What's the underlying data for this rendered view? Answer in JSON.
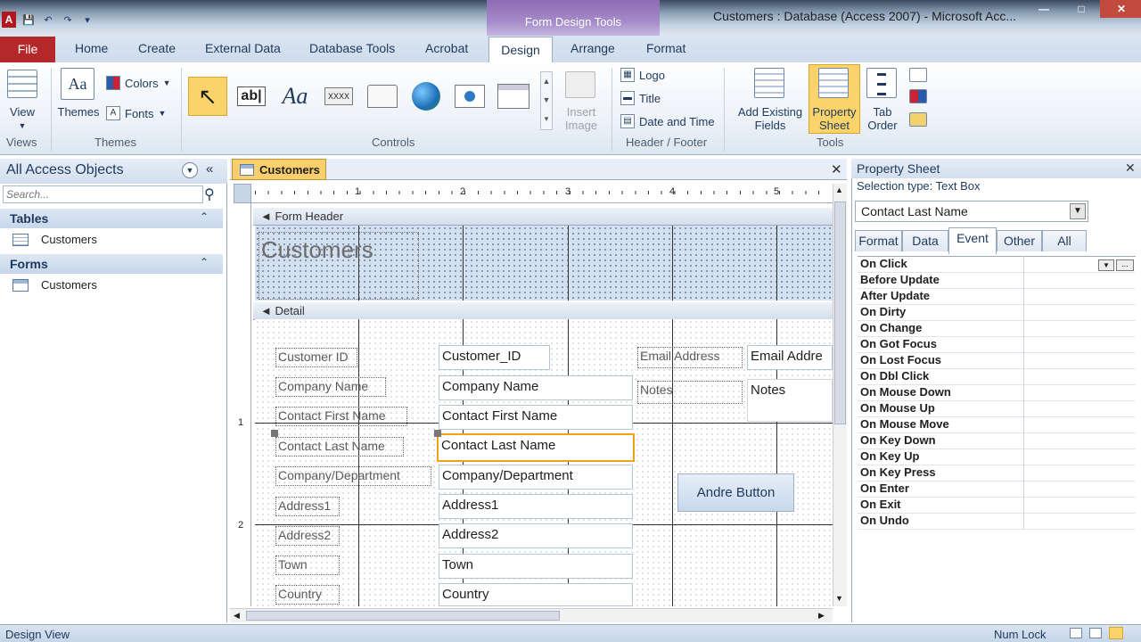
{
  "window": {
    "title": "Customers : Database (Access 2007)  -  Microsoft Acc...",
    "contextual_group": "Form Design Tools"
  },
  "ribbon_tabs": [
    "File",
    "Home",
    "Create",
    "External Data",
    "Database Tools",
    "Acrobat",
    "Design",
    "Arrange",
    "Format"
  ],
  "groups": {
    "views": {
      "label": "Views",
      "view_button": "View"
    },
    "themes": {
      "label": "Themes",
      "themes_button": "Themes",
      "colors": "Colors",
      "fonts": "Fonts"
    },
    "controls": {
      "label": "Controls",
      "insert_image": "Insert Image"
    },
    "header_footer": {
      "label": "Header / Footer",
      "logo": "Logo",
      "title": "Title",
      "date_time": "Date and Time"
    },
    "tools": {
      "label": "Tools",
      "add_fields": "Add Existing Fields",
      "property_sheet": "Property Sheet",
      "tab_order": "Tab Order"
    }
  },
  "nav": {
    "title": "All Access Objects",
    "search_placeholder": "Search...",
    "sections": [
      {
        "label": "Tables",
        "items": [
          "Customers"
        ]
      },
      {
        "label": "Forms",
        "items": [
          "Customers"
        ]
      }
    ]
  },
  "document": {
    "tab": "Customers",
    "form_header_label": "Form Header",
    "detail_label": "Detail",
    "form_title": "Customers",
    "ruler_marks": [
      "1",
      "2",
      "3",
      "4",
      "5"
    ],
    "vruler_marks": [
      "1",
      "2"
    ],
    "fields": [
      {
        "label": "Customer ID",
        "control": "Customer_ID"
      },
      {
        "label": "Company Name",
        "control": "Company Name"
      },
      {
        "label": "Contact First Name",
        "control": "Contact First Name"
      },
      {
        "label": "Contact Last Name",
        "control": "Contact Last Name"
      },
      {
        "label": "Company/Department",
        "control": "Company/Department"
      },
      {
        "label": "Address1",
        "control": "Address1"
      },
      {
        "label": "Address2",
        "control": "Address2"
      },
      {
        "label": "Town",
        "control": "Town"
      },
      {
        "label": "Country",
        "control": "Country"
      }
    ],
    "right_fields": [
      {
        "label": "Email Address",
        "control": "Email Addre"
      },
      {
        "label": "Notes",
        "control": "Notes"
      }
    ],
    "button_label": "Andre Button"
  },
  "property_sheet": {
    "title": "Property Sheet",
    "selection_type": "Selection type:  Text Box",
    "selected_object": "Contact Last Name",
    "tabs": [
      "Format",
      "Data",
      "Event",
      "Other",
      "All"
    ],
    "active_tab": "Event",
    "properties": [
      "On Click",
      "Before Update",
      "After Update",
      "On Dirty",
      "On Change",
      "On Got Focus",
      "On Lost Focus",
      "On Dbl Click",
      "On Mouse Down",
      "On Mouse Up",
      "On Mouse Move",
      "On Key Down",
      "On Key Up",
      "On Key Press",
      "On Enter",
      "On Exit",
      "On Undo"
    ]
  },
  "status": {
    "left": "Design View",
    "num_lock": "Num Lock"
  },
  "colors": {
    "file_tab": "#b5282a",
    "contextual": "#a58bc9",
    "selection": "#f0a21d",
    "doc_tab": "#f8cf6b"
  }
}
